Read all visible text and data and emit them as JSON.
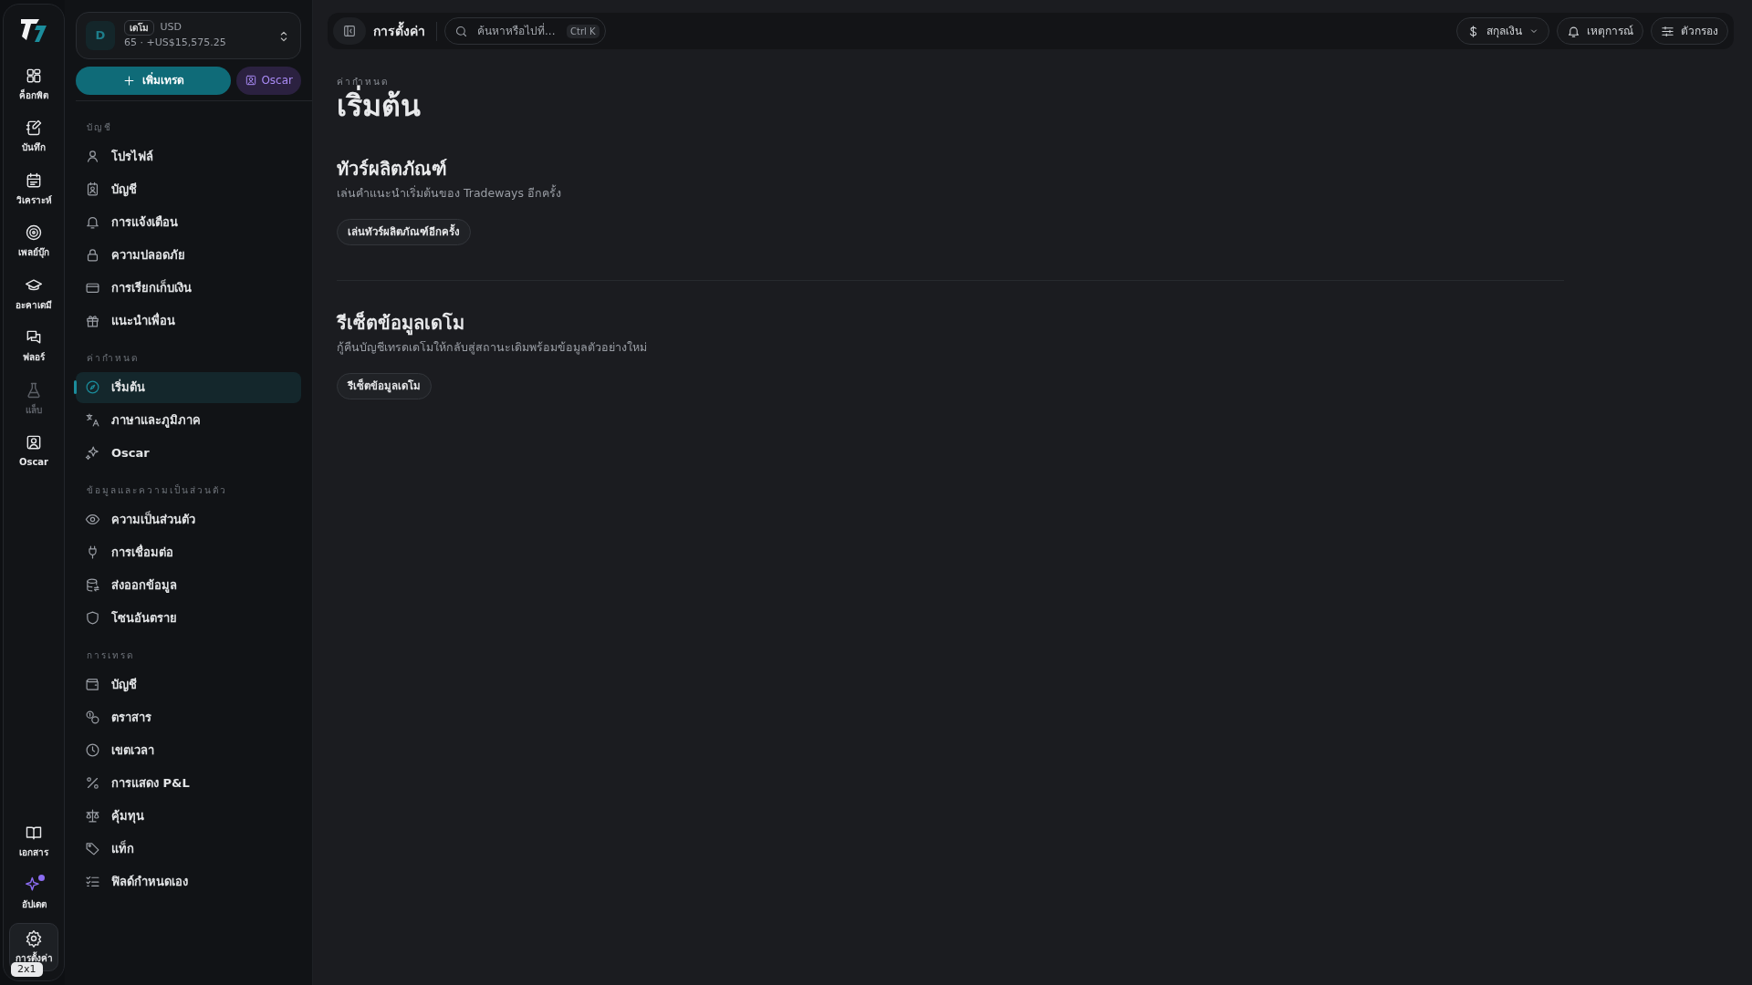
{
  "rail": {
    "items": [
      {
        "label": "ค็อกพิต",
        "selected": false,
        "disabled": false,
        "notification": false
      },
      {
        "label": "บันทึก",
        "selected": false,
        "disabled": false,
        "notification": false
      },
      {
        "label": "วิเคราะห์",
        "selected": false,
        "disabled": false,
        "notification": false
      },
      {
        "label": "เพลย์บุ๊ก",
        "selected": false,
        "disabled": false,
        "notification": false
      },
      {
        "label": "อะคาเดมี",
        "selected": false,
        "disabled": false,
        "notification": false
      },
      {
        "label": "ฟลอร์",
        "selected": false,
        "disabled": false,
        "notification": false
      },
      {
        "label": "แล็บ",
        "selected": false,
        "disabled": true,
        "notification": false
      },
      {
        "label": "Oscar",
        "selected": false,
        "disabled": false,
        "notification": false
      }
    ],
    "bottom_items": [
      {
        "label": "เอกสาร",
        "selected": false,
        "disabled": false,
        "notification": false
      },
      {
        "label": "อัปเดต",
        "selected": false,
        "disabled": false,
        "notification": true
      },
      {
        "label": "การตั้งค่า",
        "selected": true,
        "disabled": false,
        "notification": false
      }
    ],
    "overlay_badge": "2x1"
  },
  "account": {
    "avatar": "D",
    "tag": "เดโม",
    "currency": "USD",
    "summary": "65 · +US$15,575.25"
  },
  "actions": {
    "add_trade": "เพิ่มเทรด",
    "assistant": "Oscar"
  },
  "sidebar": {
    "sections": [
      {
        "title": "บัญชี",
        "items": [
          {
            "label": "โปรไฟล์",
            "selected": false
          },
          {
            "label": "บัญชี",
            "selected": false
          },
          {
            "label": "การแจ้งเตือน",
            "selected": false
          },
          {
            "label": "ความปลอดภัย",
            "selected": false
          },
          {
            "label": "การเรียกเก็บเงิน",
            "selected": false
          },
          {
            "label": "แนะนำเพื่อน",
            "selected": false
          }
        ]
      },
      {
        "title": "ค่ากำหนด",
        "items": [
          {
            "label": "เริ่มต้น",
            "selected": true
          },
          {
            "label": "ภาษาและภูมิภาค",
            "selected": false
          },
          {
            "label": "Oscar",
            "selected": false
          }
        ]
      },
      {
        "title": "ข้อมูลและความเป็นส่วนตัว",
        "items": [
          {
            "label": "ความเป็นส่วนตัว",
            "selected": false
          },
          {
            "label": "การเชื่อมต่อ",
            "selected": false
          },
          {
            "label": "ส่งออกข้อมูล",
            "selected": false
          },
          {
            "label": "โซนอันตราย",
            "selected": false
          }
        ]
      },
      {
        "title": "การเทรด",
        "items": [
          {
            "label": "บัญชี",
            "selected": false
          },
          {
            "label": "ตราสาร",
            "selected": false
          },
          {
            "label": "เขตเวลา",
            "selected": false
          },
          {
            "label": "การแสดง P&L",
            "selected": false
          },
          {
            "label": "คุ้มทุน",
            "selected": false
          },
          {
            "label": "แท็ก",
            "selected": false
          },
          {
            "label": "ฟิลด์กำหนดเอง",
            "selected": false
          }
        ]
      }
    ]
  },
  "topbar": {
    "title": "การตั้งค่า",
    "search": {
      "placeholder": "ค้นหาหรือไปที่...",
      "shortcut": "Ctrl K"
    },
    "buttons": [
      "สกุลเงิน",
      "เหตุการณ์",
      "ตัวกรอง"
    ]
  },
  "page": {
    "eyebrow": "ค่ากำหนด",
    "title": "เริ่มต้น",
    "sections": [
      {
        "heading": "ทัวร์ผลิตภัณฑ์",
        "description": "เล่นคำแนะนำเริ่มต้นของ Tradeways อีกครั้ง",
        "button": "เล่นทัวร์ผลิตภัณฑ์อีกครั้ง"
      },
      {
        "heading": "รีเซ็ตข้อมูลเดโม",
        "description": "กู้คืนบัญชีเทรดเดโมให้กลับสู่สถานะเดิมพร้อมข้อมูลตัวอย่างใหม่",
        "button": "รีเซ็ตข้อมูลเดโม"
      }
    ]
  }
}
